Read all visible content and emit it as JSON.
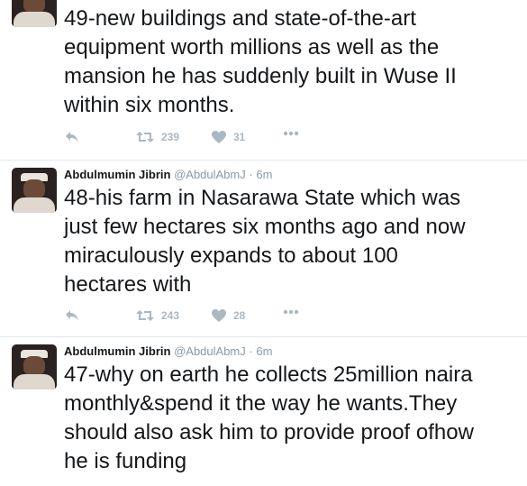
{
  "tweets": [
    {
      "text": "49-new buildings and state-of-the-art\nequipment worth millions as well as the\nmansion he has suddenly built in Wuse II\nwithin six months.",
      "retweets": "239",
      "likes": "31"
    },
    {
      "name": "Abdulmumin Jibrin",
      "handle": "@AbdulAbmJ",
      "dot": "·",
      "time": "6m",
      "text": "48-his farm in Nasarawa State which was\njust few hectares six months ago and now\nmiraculously expands to about 100\nhectares with",
      "retweets": "243",
      "likes": "28"
    },
    {
      "name": "Abdulmumin Jibrin",
      "handle": "@AbdulAbmJ",
      "dot": "·",
      "time": "6m",
      "text": "47-why on earth he collects 25million naira\nmonthly&spend it the way he wants.They\nshould also ask him to provide proof ofhow\nhe is funding"
    }
  ],
  "colors": {
    "text": "#14171a",
    "muted": "#8899a6",
    "icon": "#aab8c2",
    "divider": "#e1e8ed"
  },
  "icons": [
    "reply-icon",
    "retweet-icon",
    "heart-icon",
    "more-icon"
  ]
}
